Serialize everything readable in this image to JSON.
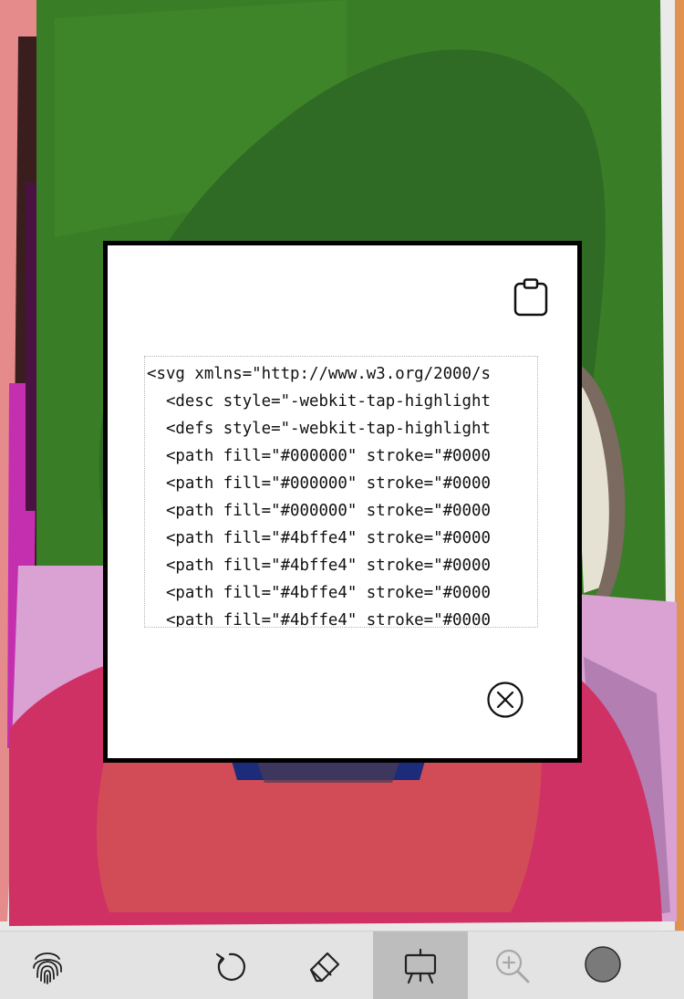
{
  "modal": {
    "code_lines": [
      "<svg xmlns=\"http://www.w3.org/2000/s",
      "  <desc style=\"-webkit-tap-highlight",
      "  <defs style=\"-webkit-tap-highlight",
      "  <path fill=\"#000000\" stroke=\"#0000",
      "  <path fill=\"#000000\" stroke=\"#0000",
      "  <path fill=\"#000000\" stroke=\"#0000",
      "  <path fill=\"#4bffe4\" stroke=\"#0000",
      "  <path fill=\"#4bffe4\" stroke=\"#0000",
      "  <path fill=\"#4bffe4\" stroke=\"#0000",
      "  <path fill=\"#4bffe4\" stroke=\"#0000"
    ],
    "copy_icon": "clipboard-icon",
    "close_icon": "close-circle-icon"
  },
  "toolbar": {
    "tools": [
      {
        "id": "fingerprint",
        "icon": "fingerprint-icon",
        "active": false
      },
      {
        "id": "undo",
        "icon": "undo-icon",
        "active": false
      },
      {
        "id": "eraser",
        "icon": "eraser-icon",
        "active": false
      },
      {
        "id": "easel",
        "icon": "easel-icon",
        "active": true
      },
      {
        "id": "zoom",
        "icon": "zoom-in-icon",
        "active": false,
        "disabled": true
      },
      {
        "id": "color",
        "icon": "color-swatch-icon",
        "active": false
      }
    ],
    "current_color": "#7a7a7a"
  },
  "colors": {
    "green": "#3a7d27",
    "dark_green": "#2e6b22",
    "pink": "#d99fd0",
    "crimson": "#cf3165",
    "magenta": "#c530b5",
    "orange": "#e0904a"
  }
}
